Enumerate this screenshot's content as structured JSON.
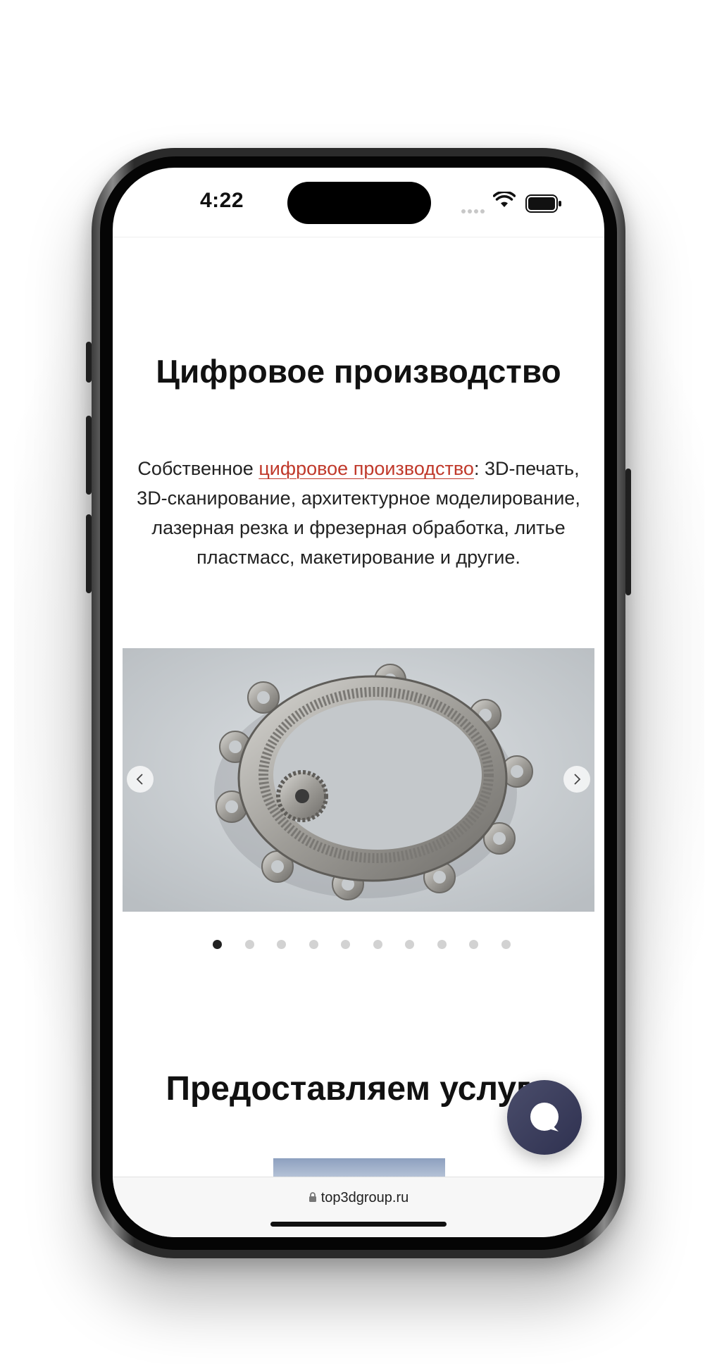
{
  "status_bar": {
    "time": "4:22"
  },
  "page": {
    "title": "Цифровое производство",
    "intro_before": "Собственное ",
    "intro_link": "цифровое производство",
    "intro_after": ": 3D-печать, 3D-сканирование, архитектурное моделирование, лазерная резка и фрезерная обработка, литье пластмасс, макетирование и другие.",
    "services_title": "Предоставляем услуги"
  },
  "slider": {
    "image_subject": "metal-printed-ring-gear",
    "prev_icon": "chevron-left-icon",
    "next_icon": "chevron-right-icon",
    "dots_total": 10,
    "active_index": 0
  },
  "chat_widget": {
    "icon": "chat-bubble-icon",
    "color": "#3c3e5c"
  },
  "browser": {
    "url": "top3dgroup.ru",
    "lock_icon": "lock-icon"
  },
  "colors": {
    "link": "#c0392b",
    "text": "#111111"
  }
}
